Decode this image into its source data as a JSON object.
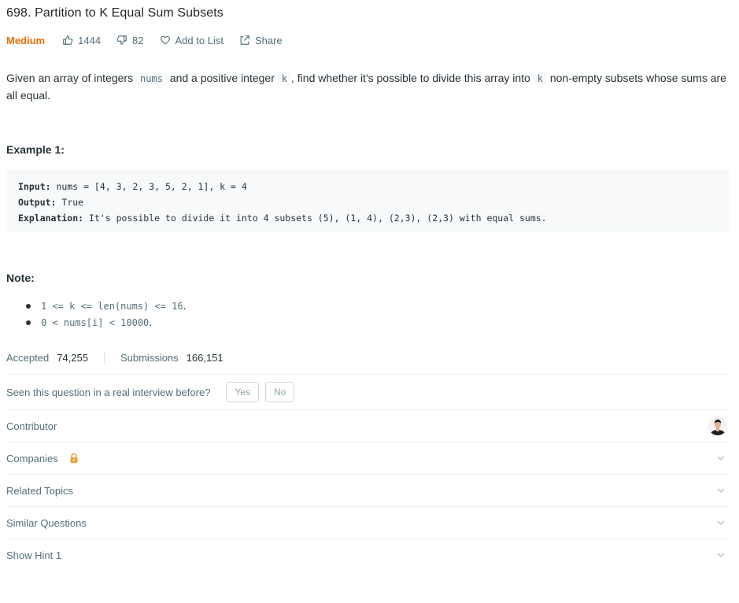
{
  "problem": {
    "title": "698. Partition to K Equal Sum Subsets",
    "difficulty": "Medium",
    "likes": "1444",
    "dislikes": "82",
    "add_to_list": "Add to List",
    "share": "Share"
  },
  "description": {
    "part1": "Given an array of integers ",
    "code1": "nums",
    "part2": " and a positive integer ",
    "code2": "k",
    "part3": ", find whether it's possible to divide this array into ",
    "code3": "k",
    "part4": " non-empty subsets whose sums are all equal."
  },
  "example": {
    "heading": "Example 1:",
    "input_label": "Input:",
    "input_value": " nums = [4, 3, 2, 3, 5, 2, 1], k = 4",
    "output_label": "Output:",
    "output_value": " True",
    "explanation_label": "Explanation:",
    "explanation_value": " It's possible to divide it into 4 subsets (5), (1, 4), (2,3), (2,3) with equal sums."
  },
  "note": {
    "heading": "Note:",
    "items": [
      {
        "code": "1 <= k <= len(nums) <= 16",
        "suffix": "."
      },
      {
        "code": "0 < nums[i] < 10000",
        "suffix": "."
      }
    ]
  },
  "stats": {
    "accepted_label": "Accepted",
    "accepted_value": "74,255",
    "submissions_label": "Submissions",
    "submissions_value": "166,151"
  },
  "interview": {
    "question": "Seen this question in a real interview before?",
    "yes": "Yes",
    "no": "No"
  },
  "sections": {
    "contributor": "Contributor",
    "companies": "Companies",
    "related_topics": "Related Topics",
    "similar_questions": "Similar Questions",
    "show_hint": "Show Hint 1"
  },
  "icons": {
    "like": "thumbs-up-icon",
    "dislike": "thumbs-down-icon",
    "heart": "heart-icon",
    "share": "share-icon",
    "lock": "lock-icon",
    "chevron": "chevron-down-icon"
  },
  "colors": {
    "difficulty_medium": "#ef6c00",
    "lock": "#e8a33d"
  }
}
